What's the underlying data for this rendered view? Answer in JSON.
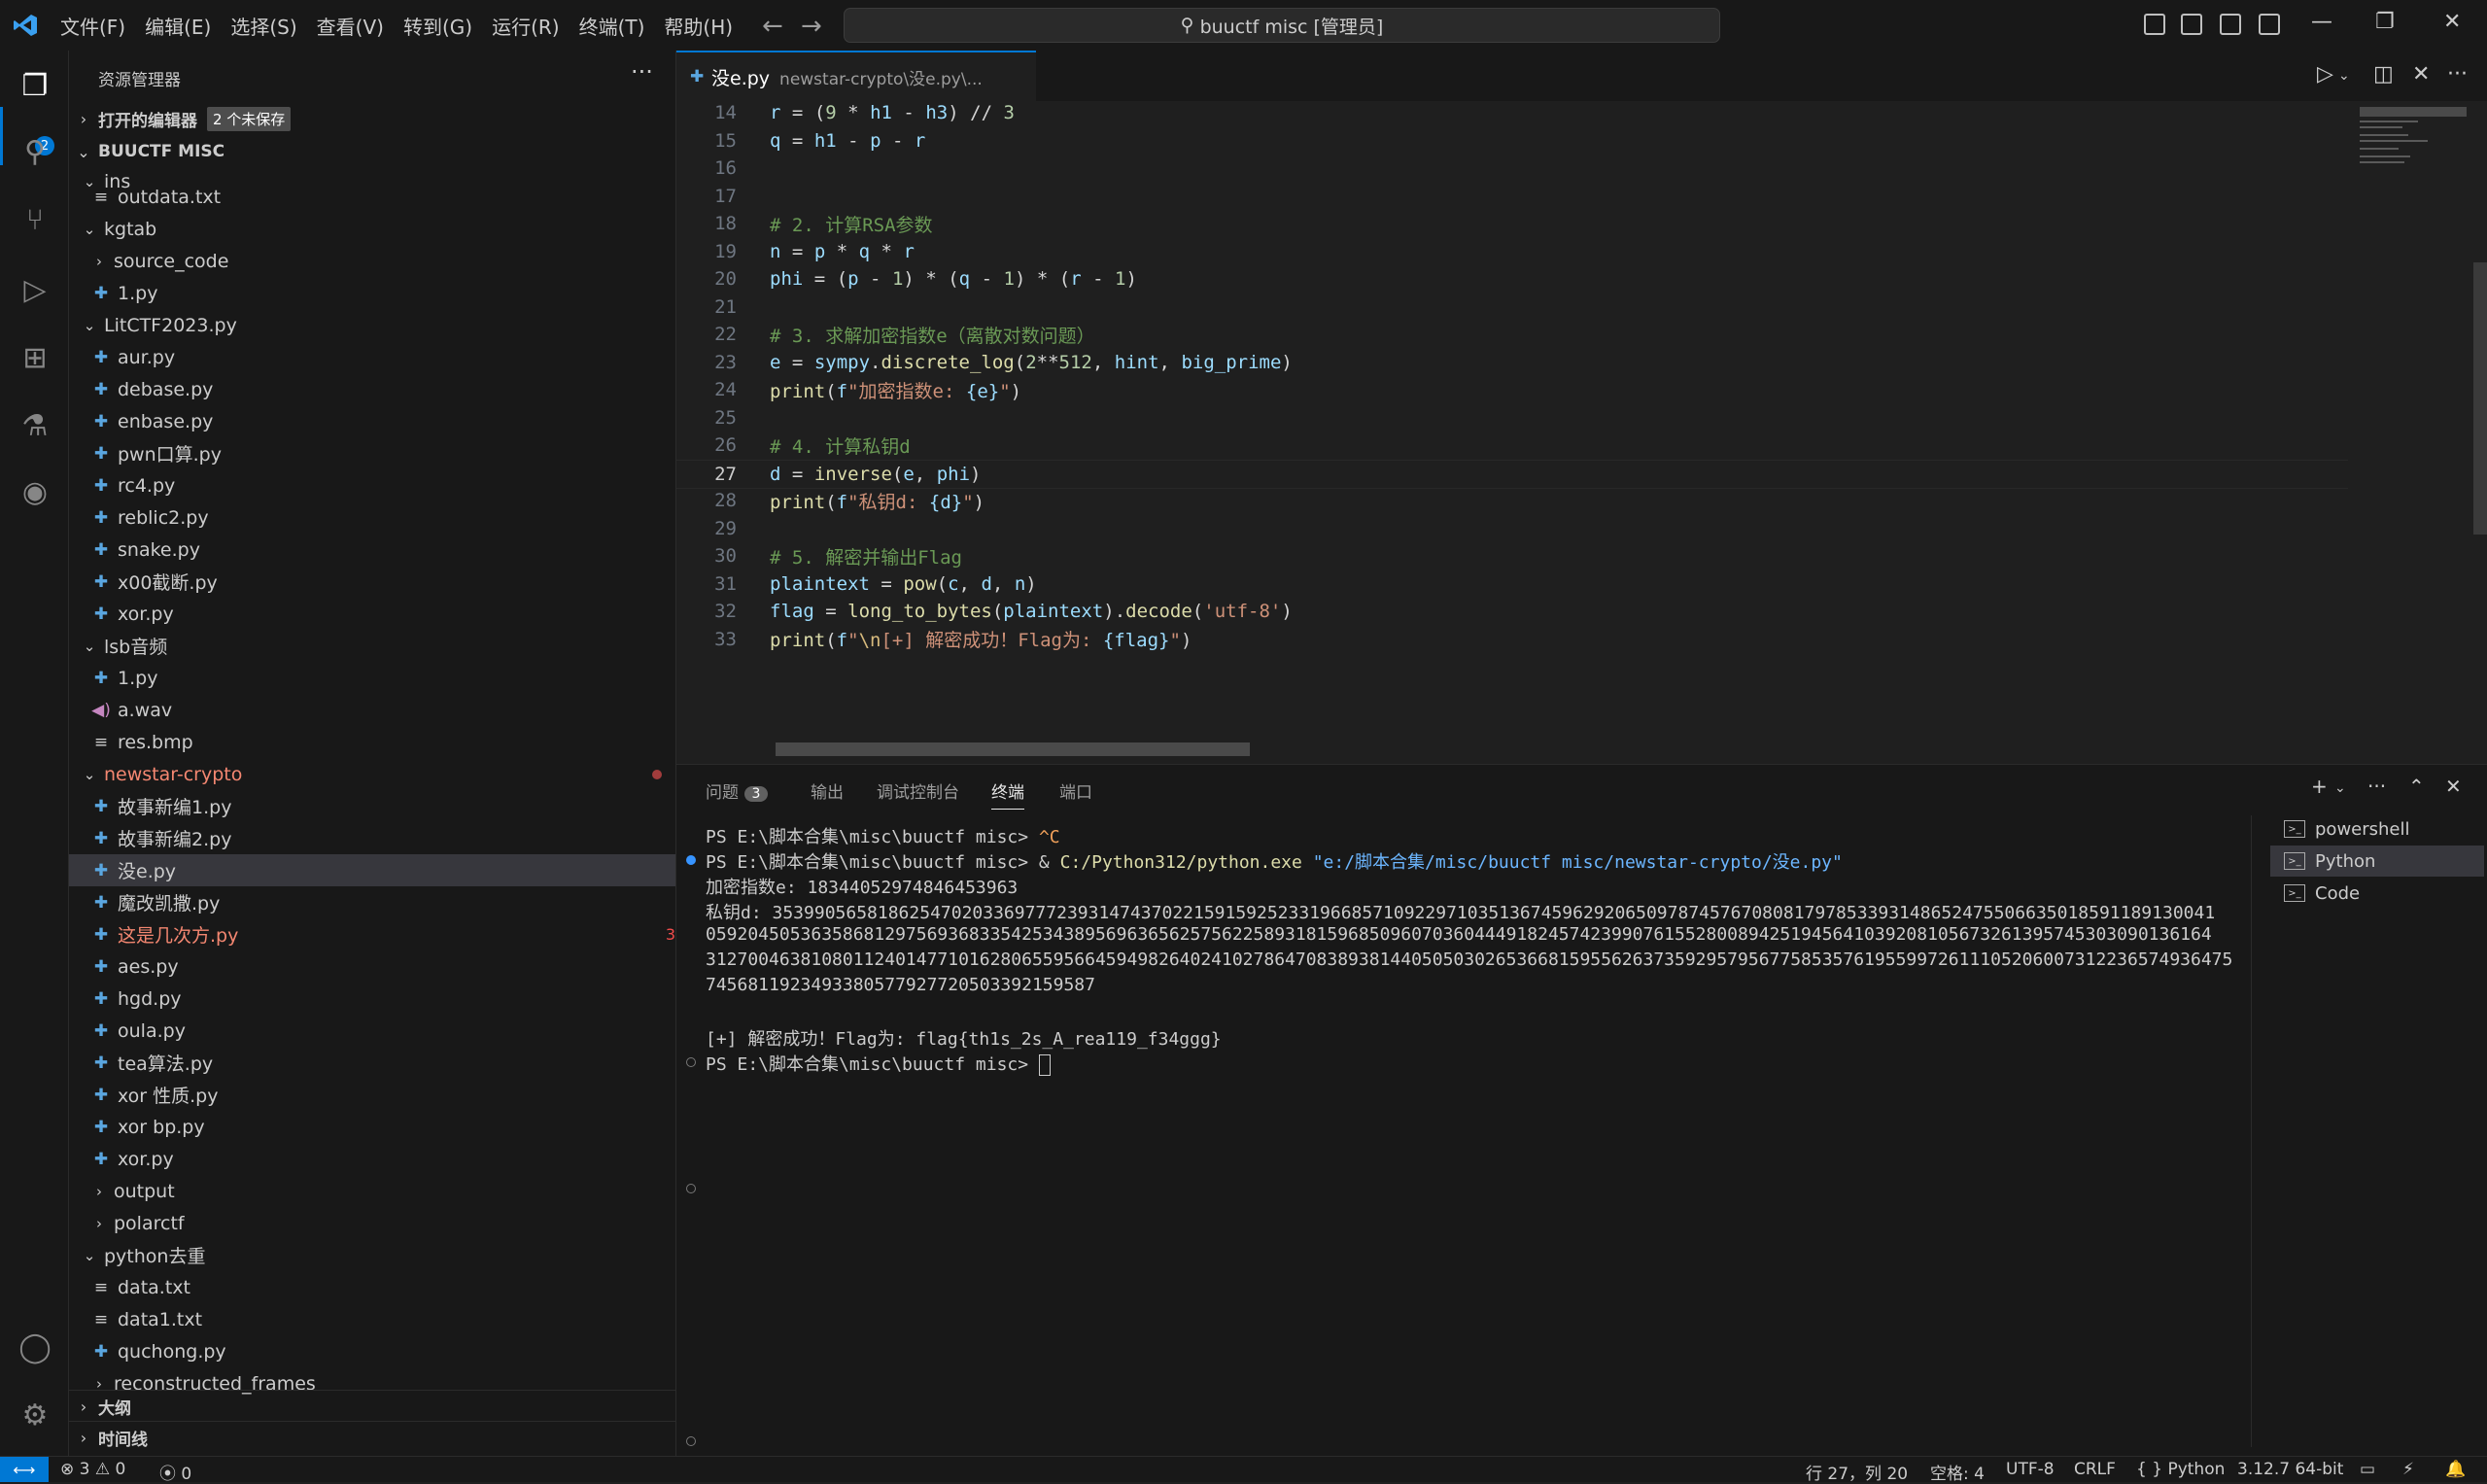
{
  "titlebar": {
    "menus": [
      "文件(F)",
      "编辑(E)",
      "选择(S)",
      "查看(V)",
      "转到(G)",
      "运行(R)",
      "终端(T)",
      "帮助(H)"
    ],
    "search": "buuctf misc [管理员]"
  },
  "activity": {
    "explorer_badge": "2"
  },
  "sidebar": {
    "title": "资源管理器",
    "open_editors": "打开的编辑器",
    "unsaved": "2 个未保存",
    "workspace": "BUUCTF MISC",
    "outline": "大纲",
    "timeline": "时间线",
    "tree": [
      {
        "label": "ins",
        "type": "folder-open"
      },
      {
        "label": "outdata.txt",
        "type": "txt"
      },
      {
        "label": "kgtab",
        "type": "folder-open"
      },
      {
        "label": "source_code",
        "type": "folder-closed"
      },
      {
        "label": "1.py",
        "type": "py"
      },
      {
        "label": "LitCTF2023.py",
        "type": "folder-open"
      },
      {
        "label": "aur.py",
        "type": "py"
      },
      {
        "label": "debase.py",
        "type": "py"
      },
      {
        "label": "enbase.py",
        "type": "py"
      },
      {
        "label": "pwn口算.py",
        "type": "py"
      },
      {
        "label": "rc4.py",
        "type": "py"
      },
      {
        "label": "reblic2.py",
        "type": "py"
      },
      {
        "label": "snake.py",
        "type": "py"
      },
      {
        "label": "x00截断.py",
        "type": "py"
      },
      {
        "label": "xor.py",
        "type": "py"
      },
      {
        "label": "lsb音频",
        "type": "folder-open"
      },
      {
        "label": "1.py",
        "type": "py"
      },
      {
        "label": "a.wav",
        "type": "wav"
      },
      {
        "label": "res.bmp",
        "type": "txt"
      },
      {
        "label": "newstar-crypto",
        "type": "folder-open"
      },
      {
        "label": "故事新编1.py",
        "type": "py"
      },
      {
        "label": "故事新编2.py",
        "type": "py"
      },
      {
        "label": "没e.py",
        "type": "py"
      },
      {
        "label": "魔改凯撒.py",
        "type": "py"
      },
      {
        "label": "这是几次方.py",
        "type": "py",
        "badge": "3"
      },
      {
        "label": "aes.py",
        "type": "py"
      },
      {
        "label": "hgd.py",
        "type": "py"
      },
      {
        "label": "oula.py",
        "type": "py"
      },
      {
        "label": "tea算法.py",
        "type": "py"
      },
      {
        "label": "xor 性质.py",
        "type": "py"
      },
      {
        "label": "xor bp.py",
        "type": "py"
      },
      {
        "label": "xor.py",
        "type": "py"
      },
      {
        "label": "output",
        "type": "folder-closed"
      },
      {
        "label": "polarctf",
        "type": "folder-closed"
      },
      {
        "label": "python去重",
        "type": "folder-open"
      },
      {
        "label": "data.txt",
        "type": "txt"
      },
      {
        "label": "data1.txt",
        "type": "txt"
      },
      {
        "label": "quchong.py",
        "type": "py"
      },
      {
        "label": "reconstructed_frames",
        "type": "folder-closed"
      }
    ]
  },
  "editor": {
    "tab_name": "没e.py",
    "tab_desc": "newstar-crypto\\没e.py\\...",
    "lines": [
      {
        "n": "14",
        "t": "r = (9 * h1 - h3) // 3"
      },
      {
        "n": "15",
        "t": "q = h1 - p - r"
      },
      {
        "n": "16",
        "t": ""
      },
      {
        "n": "17",
        "t": ""
      },
      {
        "n": "18",
        "t": "# 2. 计算RSA参数"
      },
      {
        "n": "19",
        "t": "n = p * q * r"
      },
      {
        "n": "20",
        "t": "phi = (p - 1) * (q - 1) * (r - 1)"
      },
      {
        "n": "21",
        "t": ""
      },
      {
        "n": "22",
        "t": "# 3. 求解加密指数e（离散对数问题）"
      },
      {
        "n": "23",
        "t": "e = sympy.discrete_log(2**512, hint, big_prime)"
      },
      {
        "n": "24",
        "t": "print(f\"加密指数e: {e}\")"
      },
      {
        "n": "25",
        "t": ""
      },
      {
        "n": "26",
        "t": "# 4. 计算私钥d"
      },
      {
        "n": "27",
        "t": "d = inverse(e, phi)"
      },
      {
        "n": "28",
        "t": "print(f\"私钥d: {d}\")"
      },
      {
        "n": "29",
        "t": ""
      },
      {
        "n": "30",
        "t": "# 5. 解密并输出Flag"
      },
      {
        "n": "31",
        "t": "plaintext = pow(c, d, n)"
      },
      {
        "n": "32",
        "t": "flag = long_to_bytes(plaintext).decode('utf-8')"
      },
      {
        "n": "33",
        "t": "print(f\"\\n[+] 解密成功！Flag为: {flag}\")"
      }
    ]
  },
  "panel": {
    "tabs": [
      "问题",
      "输出",
      "调试控制台",
      "终端",
      "端口"
    ],
    "problems_count": "3",
    "terminal": {
      "line1_prompt": "PS E:\\脚本合集\\misc\\buuctf misc> ",
      "line1_ctrl": "^C",
      "line2_prompt": "PS E:\\脚本合集\\misc\\buuctf misc> & ",
      "line2_exe": "C:/Python312/python.exe",
      "line2_arg": " \"e:/脚本合集/misc/buuctf misc/newstar-crypto/没e.py\"",
      "line3": "加密指数e: 18344052974846453963",
      "line4": "私钥d: 35399056581862547020336977723931474370221591592523319668571092297103513674596292065097874576708081797853393148652475506635018591189130041",
      "line5": "05920450536358681297569368335425343895696365625756225893181596850960703604449182457423990761552800894251945641039208105673261395745303090136164",
      "line6": "3127004638108011240147710162806559566459498264024102786470838938144050503026536681595562637359295795677585357619559972611105206007312236574936475",
      "line7": "7456811923493380577927720503392159587",
      "line8": "",
      "line9": "[+] 解密成功！Flag为: flag{th1s_2s_A_rea119_f34ggg}",
      "line10_prompt": "PS E:\\脚本合集\\misc\\buuctf misc> "
    },
    "terminals": [
      "powershell",
      "Python",
      "Code"
    ]
  },
  "status": {
    "errors": "3",
    "warnings": "0",
    "ports": "0",
    "position": "行 27，列 20",
    "spaces": "空格: 4",
    "encoding": "UTF-8",
    "eol": "CRLF",
    "language": "Python",
    "interpreter": "3.12.7 64-bit"
  }
}
